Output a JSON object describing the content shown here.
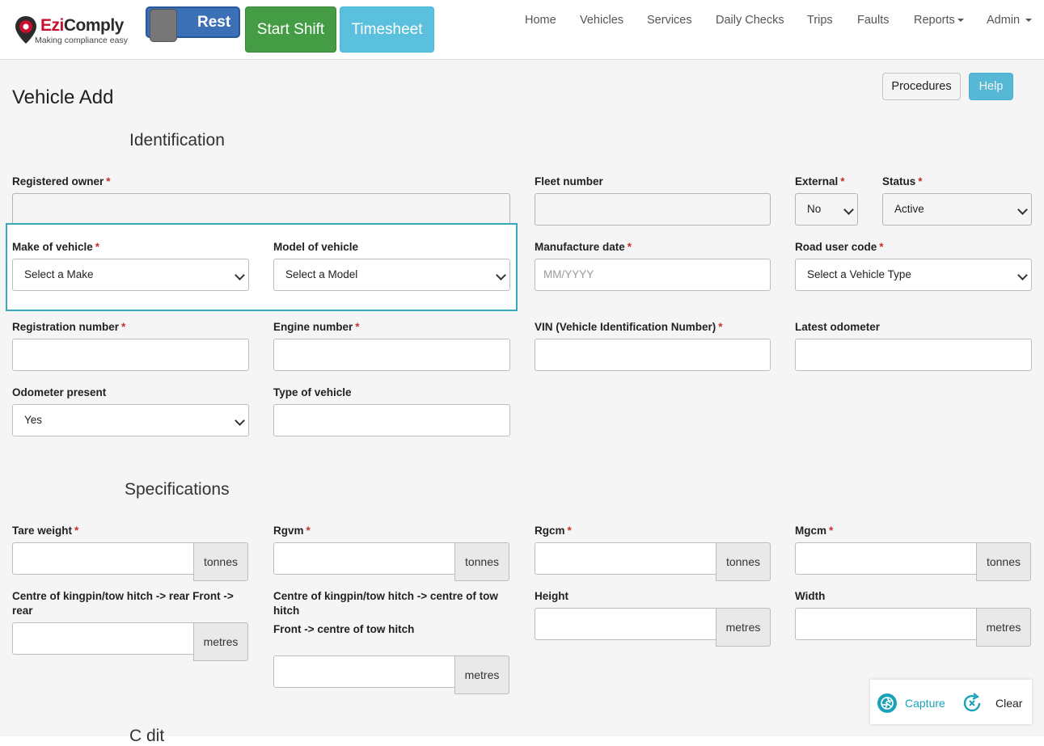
{
  "brand": {
    "name_first": "Ezi",
    "name_rest": "Comply",
    "tagline": "Making compliance easy",
    "accent": "#c8102e"
  },
  "header": {
    "toggle_label": "Rest",
    "start_shift": "Start Shift",
    "timesheet": "Timesheet",
    "nav": [
      "Home",
      "Vehicles",
      "Services",
      "Daily Checks",
      "Trips",
      "Faults",
      "Reports",
      "Admin"
    ]
  },
  "page": {
    "title": "Vehicle Add",
    "procedures": "Procedures",
    "help": "Help"
  },
  "sections": {
    "identification": "Identification",
    "specifications": "Specifications",
    "next_partial": "C   dit"
  },
  "fields": {
    "registered_owner": {
      "label": "Registered owner",
      "value": ""
    },
    "fleet_number": {
      "label": "Fleet number",
      "value": ""
    },
    "external": {
      "label": "External",
      "value": "No"
    },
    "status": {
      "label": "Status",
      "value": "Active"
    },
    "make": {
      "label": "Make of vehicle",
      "value": "Select a Make"
    },
    "model": {
      "label": "Model of vehicle",
      "value": "Select a Model"
    },
    "manufacture_date": {
      "label": "Manufacture date",
      "placeholder": "MM/YYYY"
    },
    "road_user_code": {
      "label": "Road user code",
      "value": "Select a Vehicle Type"
    },
    "registration_number": {
      "label": "Registration number",
      "value": ""
    },
    "engine_number": {
      "label": "Engine number",
      "value": ""
    },
    "vin": {
      "label": "VIN (Vehicle Identification Number)",
      "value": ""
    },
    "latest_odometer": {
      "label": "Latest odometer",
      "value": ""
    },
    "odometer_present": {
      "label": "Odometer present",
      "value": "Yes"
    },
    "type_of_vehicle": {
      "label": "Type of vehicle",
      "value": ""
    },
    "tare_weight": {
      "label": "Tare weight",
      "unit": "tonnes"
    },
    "rgvm": {
      "label": "Rgvm",
      "unit": "tonnes"
    },
    "rgcm": {
      "label": "Rgcm",
      "unit": "tonnes"
    },
    "mgcm": {
      "label": "Mgcm",
      "unit": "tonnes"
    },
    "kingpin_rear": {
      "label": "Centre of kingpin/tow hitch -> rear Front -> rear",
      "unit": "metres"
    },
    "kingpin_tow": {
      "label_1": "Centre of kingpin/tow hitch -> centre of tow hitch",
      "label_2": "Front -> centre of tow hitch",
      "unit": "metres"
    },
    "height": {
      "label": "Height",
      "unit": "metres"
    },
    "width": {
      "label": "Width",
      "unit": "metres"
    }
  },
  "capture": {
    "capture": "Capture",
    "clear": "Clear",
    "color": "#1aa3b8"
  }
}
